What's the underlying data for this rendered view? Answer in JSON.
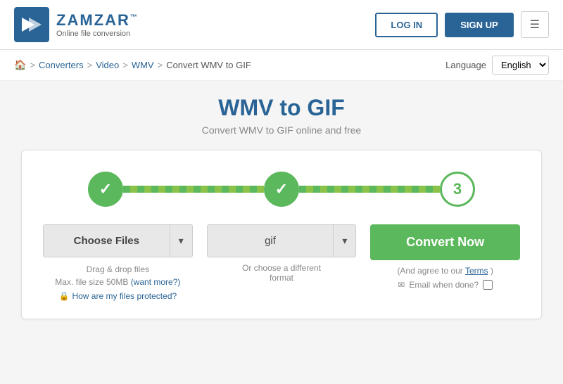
{
  "header": {
    "logo_name": "ZAMZAR",
    "logo_tm": "™",
    "logo_tagline": "Online file conversion",
    "login_label": "LOG IN",
    "signup_label": "SIGN UP"
  },
  "breadcrumb": {
    "home_icon": "🏠",
    "converters_label": "Converters",
    "video_label": "Video",
    "wmv_label": "WMV",
    "current_label": "Convert WMV to GIF",
    "language_label": "Language",
    "language_value": "English"
  },
  "page": {
    "title": "WMV to GIF",
    "subtitle": "Convert WMV to GIF online and free"
  },
  "steps": {
    "step1": "✓",
    "step2": "✓",
    "step3": "3"
  },
  "actions": {
    "choose_files": "Choose Files",
    "dropdown_arrow": "▾",
    "drag_text": "Drag & drop files",
    "max_size": "Max. file size 50MB",
    "want_more": "(want more?)",
    "protect_text": "How are my files protected?",
    "format_value": "gif",
    "format_hint1": "Or choose a different",
    "format_hint2": "format",
    "convert_label": "Convert Now",
    "terms_text": "(And agree to our",
    "terms_link": "Terms",
    "terms_close": ")",
    "email_label": "Email when done?",
    "email_icon": "✉"
  }
}
